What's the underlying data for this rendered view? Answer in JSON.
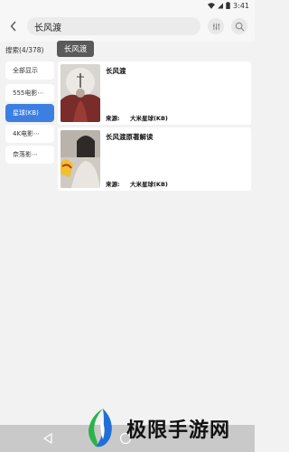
{
  "status_bar": {
    "time": "3:41"
  },
  "top_bar": {
    "search_query": "长风渡"
  },
  "search_info": {
    "count_label": "搜索(4/378)",
    "keyword_chip": "长风渡"
  },
  "sources": [
    {
      "label": "全部显示",
      "active": false
    },
    {
      "label": "555电影⋯",
      "active": false
    },
    {
      "label": "星球(KB)",
      "active": true
    },
    {
      "label": "4K电影⋯",
      "active": false
    },
    {
      "label": "奈落影⋯",
      "active": false
    }
  ],
  "results": [
    {
      "title": "长风渡",
      "source_label": "来源:",
      "source_name": "大米星球(KB)"
    },
    {
      "title": "长风渡原著解读",
      "source_label": "来源:",
      "source_name": "大米星球(KB)"
    }
  ],
  "watermark": {
    "text": "极限手游网"
  },
  "icons": {
    "back": "chevron-left-icon",
    "filter": "filter-icon",
    "search": "search-icon",
    "nav_back": "triangle-back-icon",
    "nav_home": "circle-home-icon"
  },
  "colors": {
    "active_source": "#3d7fe0",
    "chip": "#5a5a5a",
    "nav_bar": "#c9c9c9",
    "logo_blue": "#1f6fd6",
    "logo_green": "#2bb34a"
  }
}
